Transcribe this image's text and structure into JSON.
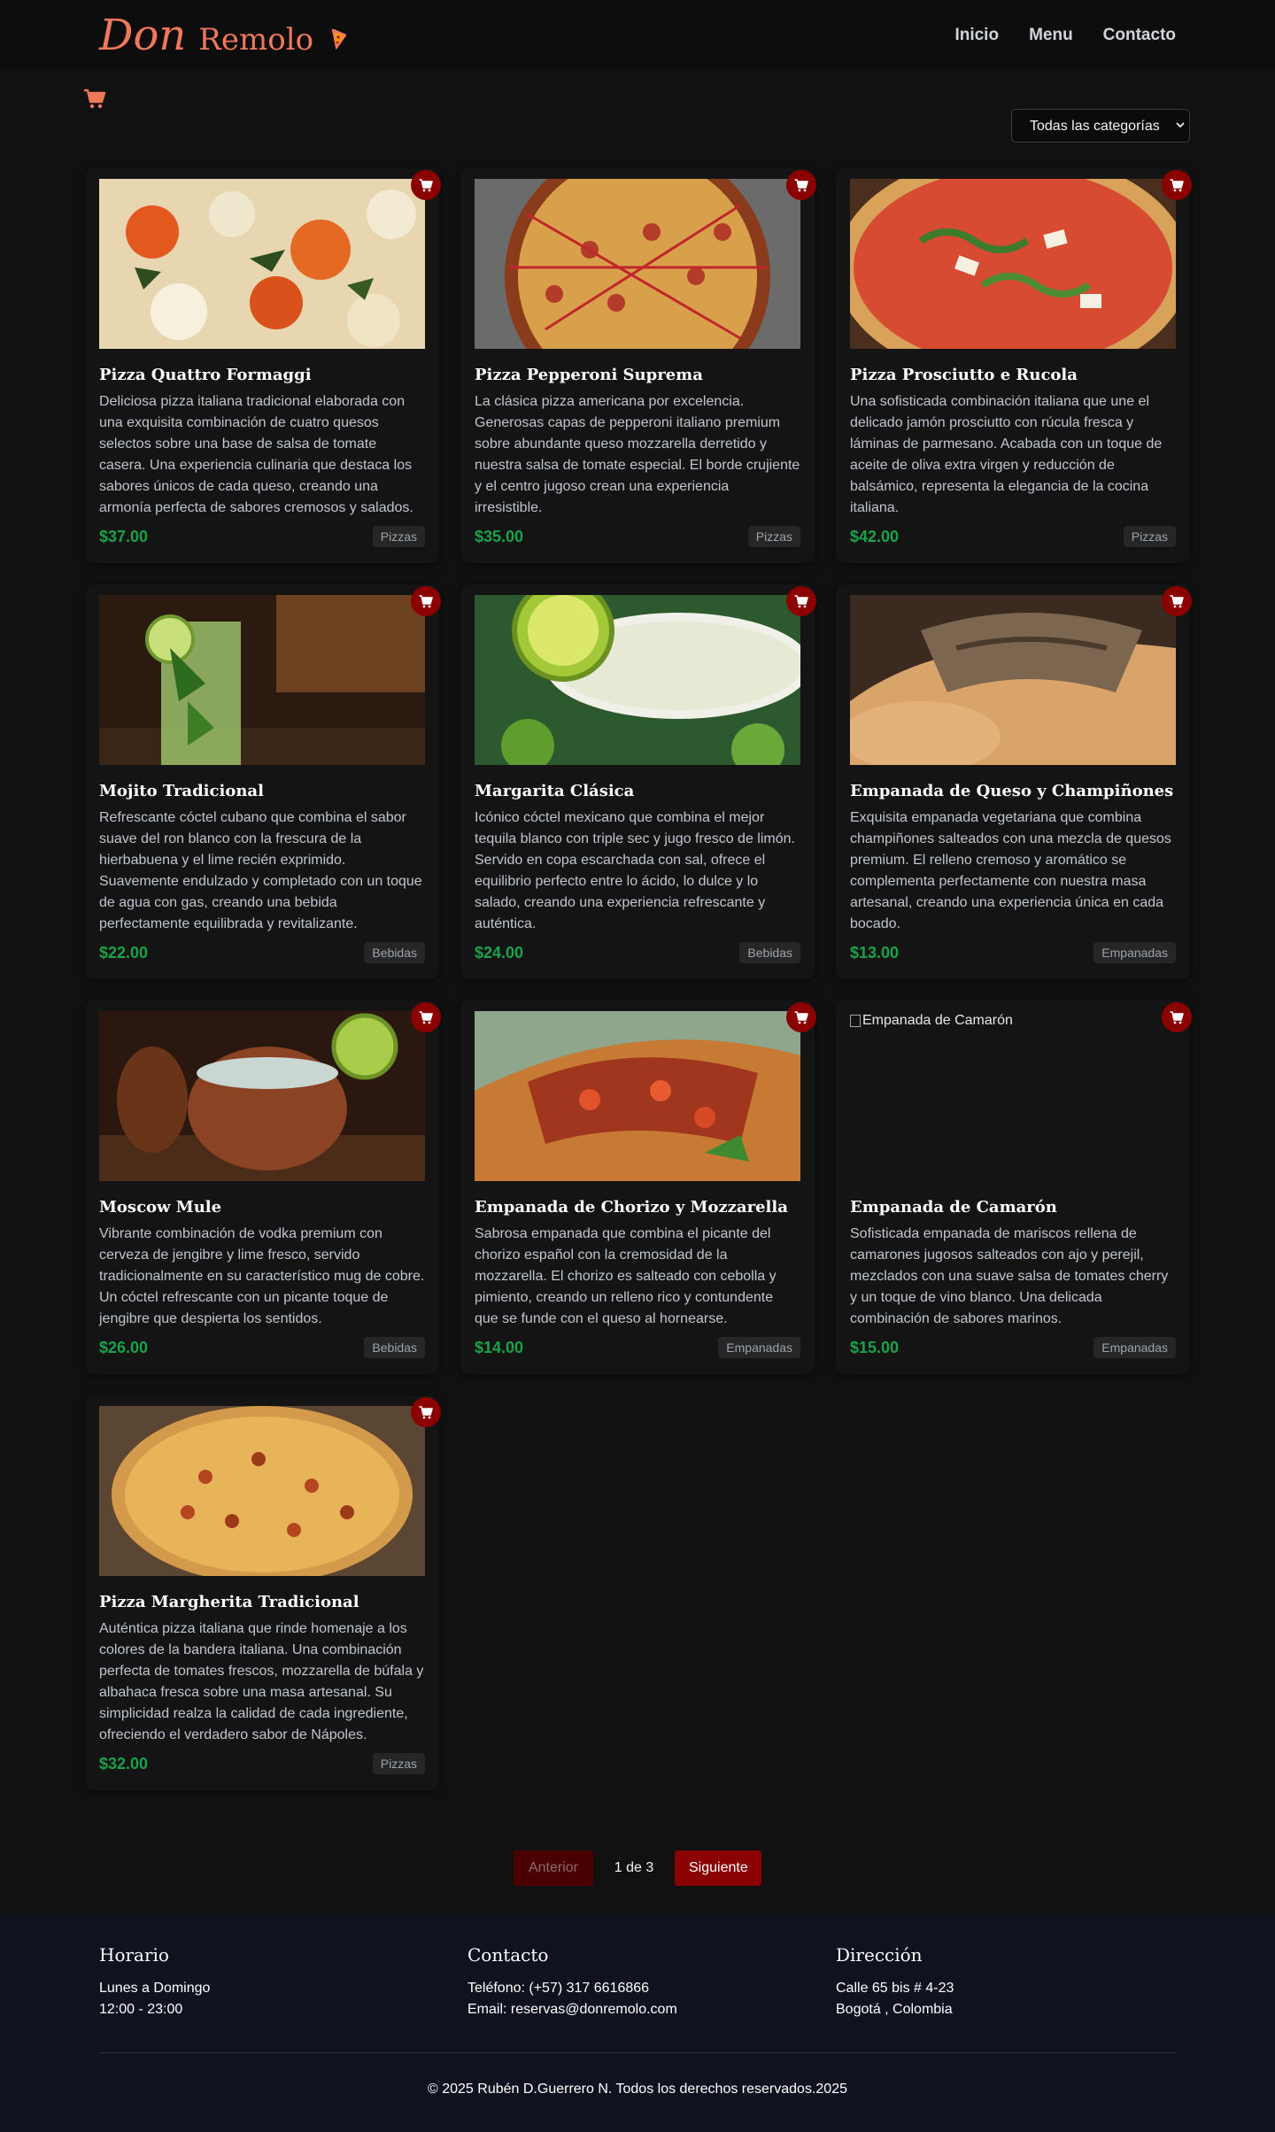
{
  "brand": {
    "word1": "Don",
    "word2": "Remolo",
    "icon": "pizza-slice-icon",
    "color": "#f0785a"
  },
  "nav": [
    {
      "label": "Inicio"
    },
    {
      "label": "Menu"
    },
    {
      "label": "Contacto"
    }
  ],
  "cart": {
    "icon": "shopping-cart-icon",
    "color": "#f0785a"
  },
  "filter": {
    "selected": "Todas las categorías"
  },
  "products": [
    {
      "name": "Pizza Quattro Formaggi",
      "description": "Deliciosa pizza italiana tradicional elaborada con una exquisita combinación de cuatro quesos selectos sobre una base de salsa de tomate casera. Una experiencia culinaria que destaca los sabores únicos de cada queso, creando una armonía perfecta de sabores cremosos y salados.",
      "price": "$37.00",
      "category": "Pizzas",
      "image": "pizza-quattro-formaggi-photo"
    },
    {
      "name": "Pizza Pepperoni Suprema",
      "description": "La clásica pizza americana por excelencia. Generosas capas de pepperoni italiano premium sobre abundante queso mozzarella derretido y nuestra salsa de tomate especial. El borde crujiente y el centro jugoso crean una experiencia irresistible.",
      "price": "$35.00",
      "category": "Pizzas",
      "image": "pizza-pepperoni-photo"
    },
    {
      "name": "Pizza Prosciutto e Rucola",
      "description": "Una sofisticada combinación italiana que une el delicado jamón prosciutto con rúcula fresca y láminas de parmesano. Acabada con un toque de aceite de oliva extra virgen y reducción de balsámico, representa la elegancia de la cocina italiana.",
      "price": "$42.00",
      "category": "Pizzas",
      "image": "pizza-prosciutto-photo"
    },
    {
      "name": "Mojito Tradicional",
      "description": "Refrescante cóctel cubano que combina el sabor suave del ron blanco con la frescura de la hierbabuena y el lime recién exprimido. Suavemente endulzado y completado con un toque de agua con gas, creando una bebida perfectamente equilibrada y revitalizante.",
      "price": "$22.00",
      "category": "Bebidas",
      "image": "mojito-photo"
    },
    {
      "name": "Margarita Clásica",
      "description": "Icónico cóctel mexicano que combina el mejor tequila blanco con triple sec y jugo fresco de limón. Servido en copa escarchada con sal, ofrece el equilibrio perfecto entre lo ácido, lo dulce y lo salado, creando una experiencia refrescante y auténtica.",
      "price": "$24.00",
      "category": "Bebidas",
      "image": "margarita-photo"
    },
    {
      "name": "Empanada de Queso y Champiñones",
      "description": "Exquisita empanada vegetariana que combina champiñones salteados con una mezcla de quesos premium. El relleno cremoso y aromático se complementa perfectamente con nuestra masa artesanal, creando una experiencia única en cada bocado.",
      "price": "$13.00",
      "category": "Empanadas",
      "image": "empanada-queso-photo"
    },
    {
      "name": "Moscow Mule",
      "description": "Vibrante combinación de vodka premium con cerveza de jengibre y lime fresco, servido tradicionalmente en su característico mug de cobre. Un cóctel refrescante con un picante toque de jengibre que despierta los sentidos.",
      "price": "$26.00",
      "category": "Bebidas",
      "image": "moscow-mule-photo"
    },
    {
      "name": "Empanada de Chorizo y Mozzarella",
      "description": "Sabrosa empanada que combina el picante del chorizo español con la cremosidad de la mozzarella. El chorizo es salteado con cebolla y pimiento, creando un relleno rico y contundente que se funde con el queso al hornearse.",
      "price": "$14.00",
      "category": "Empanadas",
      "image": "empanada-chorizo-photo"
    },
    {
      "name": "Empanada de Camarón",
      "description": "Sofisticada empanada de mariscos rellena de camarones jugosos salteados con ajo y perejil, mezclados con una suave salsa de tomates cherry y un toque de vino blanco. Una delicada combinación de sabores marinos.",
      "price": "$15.00",
      "category": "Empanadas",
      "image": "broken",
      "alt": "Empanada de Camarón"
    },
    {
      "name": "Pizza Margherita Tradicional",
      "description": "Auténtica pizza italiana que rinde homenaje a los colores de la bandera italiana. Una combinación perfecta de tomates frescos, mozzarella de búfala y albahaca fresca sobre una masa artesanal. Su simplicidad realza la calidad de cada ingrediente, ofreciendo el verdadero sabor de Nápoles.",
      "price": "$32.00",
      "category": "Pizzas",
      "image": "pizza-margherita-photo"
    }
  ],
  "pagination": {
    "prev": "Anterior",
    "info": "1 de 3",
    "next": "Siguiente"
  },
  "footer": {
    "horario": {
      "title": "Horario",
      "lines": [
        "Lunes a Domingo",
        "12:00 - 23:00"
      ]
    },
    "contacto": {
      "title": "Contacto",
      "lines": [
        "Teléfono: (+57) 317 6616866",
        "Email: reservas@donremolo.com"
      ]
    },
    "direccion": {
      "title": "Dirección",
      "lines": [
        "Calle 65 bis # 4-23",
        "Bogotá , Colombia"
      ]
    },
    "copyright": "© 2025 Rubén D.Guerrero N. Todos los derechos reservados.2025"
  },
  "colors": {
    "accent": "#8b0000",
    "price": "#16a34a",
    "footer_bg": "#0f1320"
  }
}
